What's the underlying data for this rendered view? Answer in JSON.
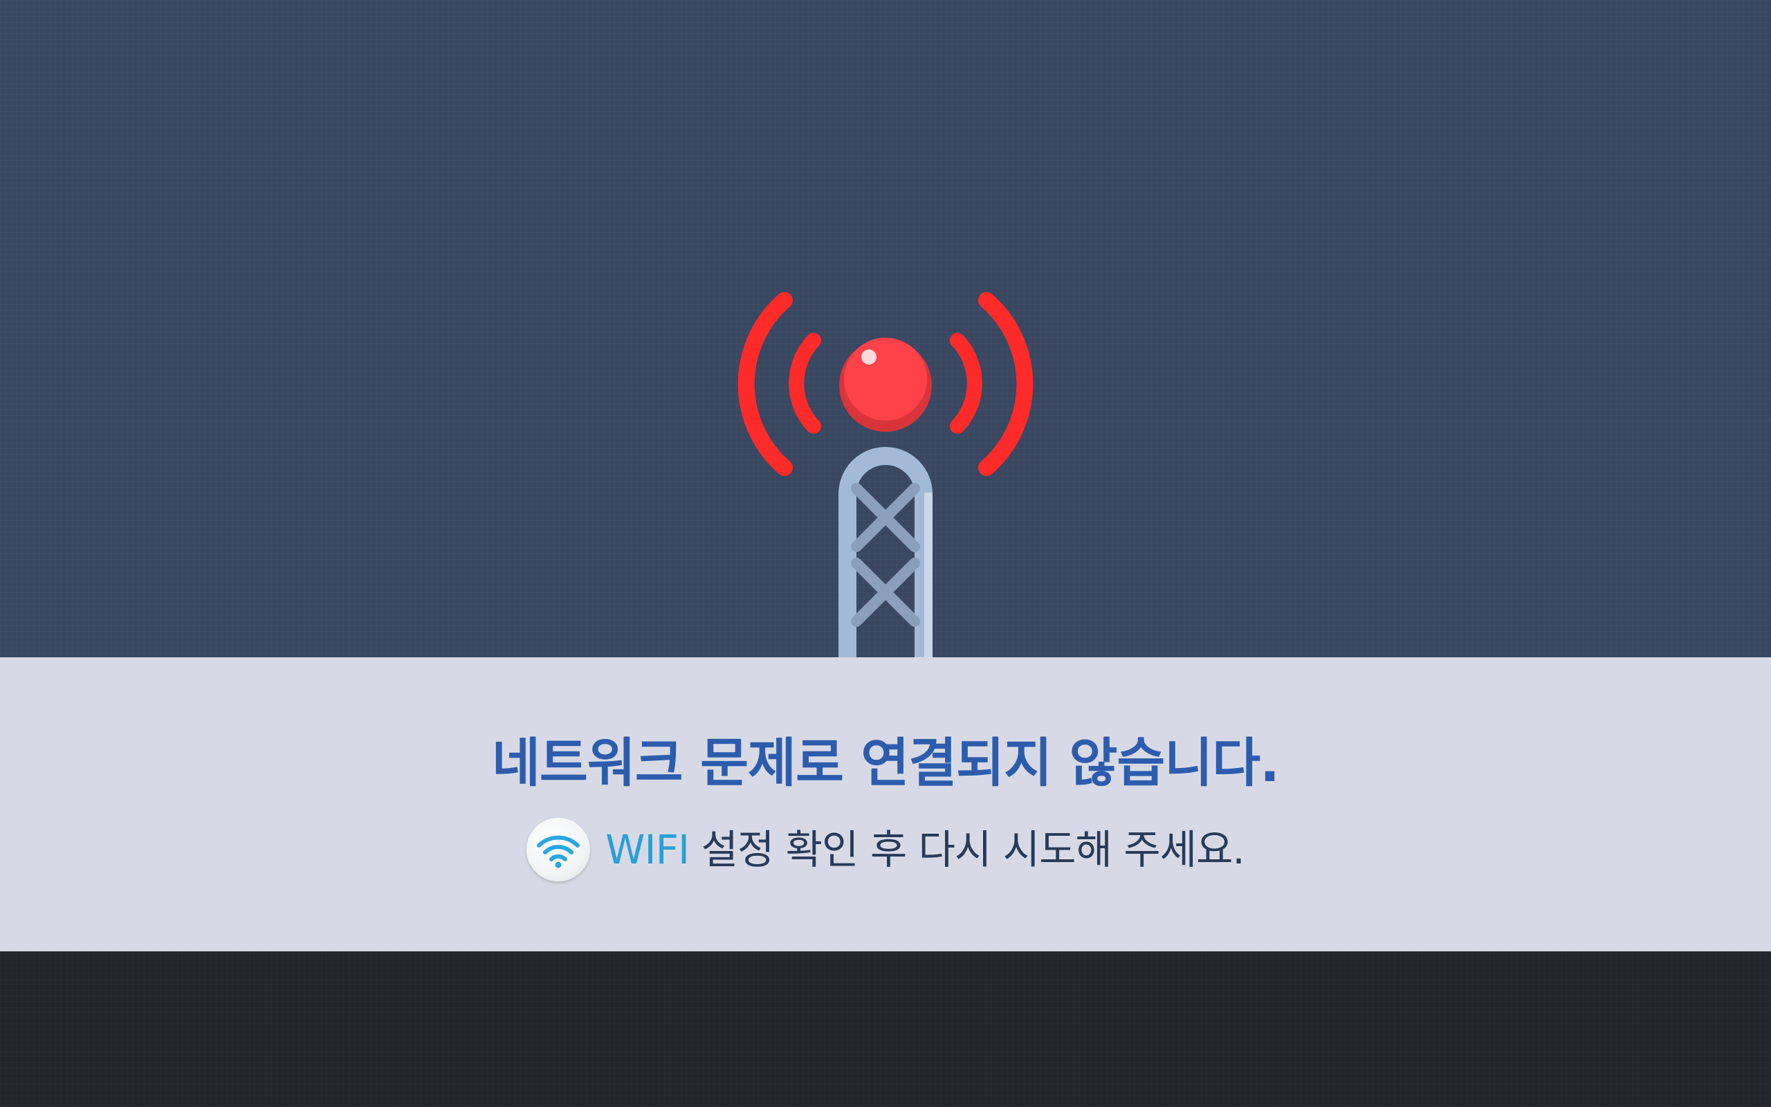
{
  "error": {
    "headline": "네트워크 문제로 연결되지 않습니다.",
    "hint_wifi": "WIFI",
    "hint_rest": " 설정 확인 후 다시 시도해 주세요."
  },
  "icons": {
    "tower": "signal-tower-icon",
    "wifi": "wifi-icon"
  },
  "colors": {
    "top_background": "#394760",
    "band_background": "#d7dae6",
    "bottom_background": "#23272b",
    "signal_red": "#ff2a2a",
    "headline_blue": "#2d5cad",
    "wifi_blue": "#2a9fd8",
    "tower_steel": "#a3bad6"
  }
}
